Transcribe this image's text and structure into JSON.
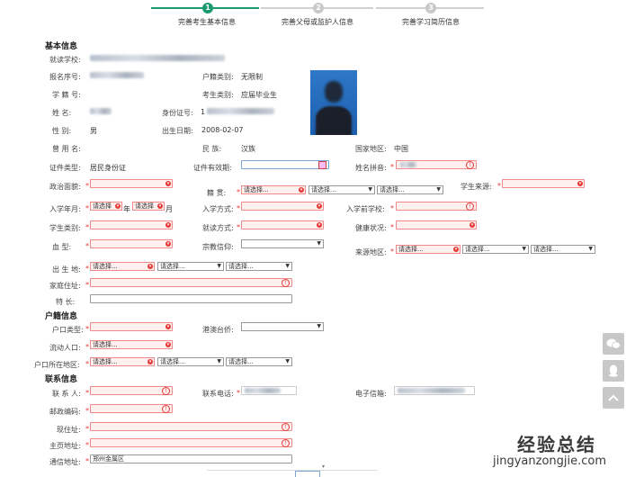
{
  "steps": [
    {
      "num": "1",
      "label": "完善考生基本信息",
      "active": true
    },
    {
      "num": "2",
      "label": "完善父母或监护人信息",
      "active": false
    },
    {
      "num": "3",
      "label": "完善学习简历信息",
      "active": false
    }
  ],
  "sections": {
    "basic": "基本信息",
    "household": "户籍信息",
    "contact": "联系信息"
  },
  "basic": {
    "school_label": "就读学校:",
    "regno_label": "报名序号:",
    "hukou_type_label": "户籍类别:",
    "hukou_type_value": "无限制",
    "stuno_label": "学  籍  号:",
    "examtype_label": "考生类别:",
    "examtype_value": "应届毕业生",
    "name_label": "姓      名:",
    "idcard_label": "身份证号:",
    "idcard_prefix": "1",
    "gender_label": "性      别:",
    "gender_value": "男",
    "birth_label": "出生日期:",
    "birth_value": "2008-02-07",
    "former_name_label": "曾  用  名:",
    "ethnic_label": "民      族:",
    "ethnic_value": "汉族",
    "country_label": "国家地区:",
    "country_value": "中国",
    "cert_type_label": "证件类型:",
    "cert_type_value": "居民身份证",
    "cert_valid_label": "证件有效期:",
    "pinyin_label": "姓名拼音:",
    "political_label": "政治面貌:",
    "native_label": "籍      贯:",
    "source_label": "学生来源:",
    "enroll_label": "入学年月:",
    "year_char": "年",
    "month_char": "月",
    "enroll_way_label": "入学方式:",
    "prev_school_label": "入学前学校:",
    "stu_type_label": "学生类别:",
    "study_way_label": "就读方式:",
    "health_label": "健康状况:",
    "blood_label": "血      型:",
    "religion_label": "宗教信仰:",
    "origin_area_label": "来源地区:",
    "birthplace_label": "出  生  地:",
    "address_label": "家庭住址:",
    "specialty_label": "特      长:"
  },
  "household": {
    "hukou_kind_label": "户口类型:",
    "hk_label": "港澳台侨:",
    "floating_label": "流动人口:",
    "hukou_area_label": "户口所在地区:"
  },
  "contact": {
    "person_label": "联  系  人:",
    "phone_label": "联系电话:",
    "email_label": "电子信箱:",
    "postcode_label": "邮政编码:",
    "current_addr_label": "现住址:",
    "home_addr_label": "主页地址:",
    "mail_addr_label": "通信地址:",
    "mail_addr_value": "郑州金属区"
  },
  "placeholders": {
    "select": "请选择..."
  },
  "select_short": "请选择",
  "required_mark": "*",
  "error_mark": "!",
  "side_icons": [
    "wechat-icon",
    "qq-icon",
    "back-to-top-icon"
  ],
  "watermark": {
    "cn": "经验总结",
    "en": "jingyanzongjie.com"
  },
  "colors": {
    "active": "#1a9a6e",
    "inactive": "#c8c8c8",
    "required": "#e53935"
  }
}
